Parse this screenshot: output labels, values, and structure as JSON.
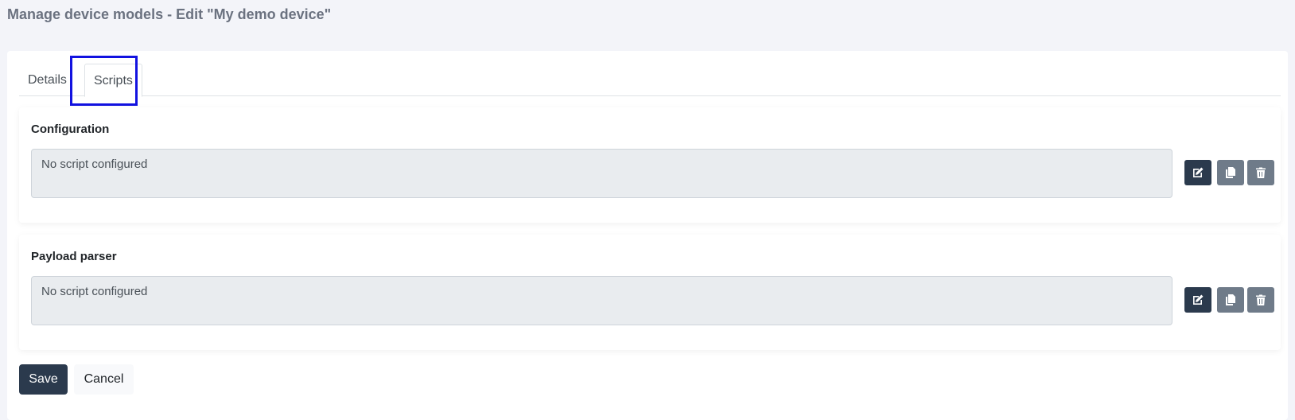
{
  "page": {
    "title": "Manage device models - Edit \"My demo device\""
  },
  "tabs": [
    {
      "label": "Details",
      "active": false
    },
    {
      "label": "Scripts",
      "active": true
    }
  ],
  "sections": {
    "configuration": {
      "title": "Configuration",
      "script_text": "No script configured",
      "icons": [
        "edit-icon",
        "copy-icon",
        "trash-icon"
      ]
    },
    "payload_parser": {
      "title": "Payload parser",
      "script_text": "No script configured",
      "icons": [
        "edit-icon",
        "copy-icon",
        "trash-icon"
      ]
    }
  },
  "actions": {
    "save_label": "Save",
    "cancel_label": "Cancel"
  },
  "colors": {
    "primary": "#2b3a4d",
    "secondary": "#6f7b89",
    "highlight": "#1212e0"
  }
}
